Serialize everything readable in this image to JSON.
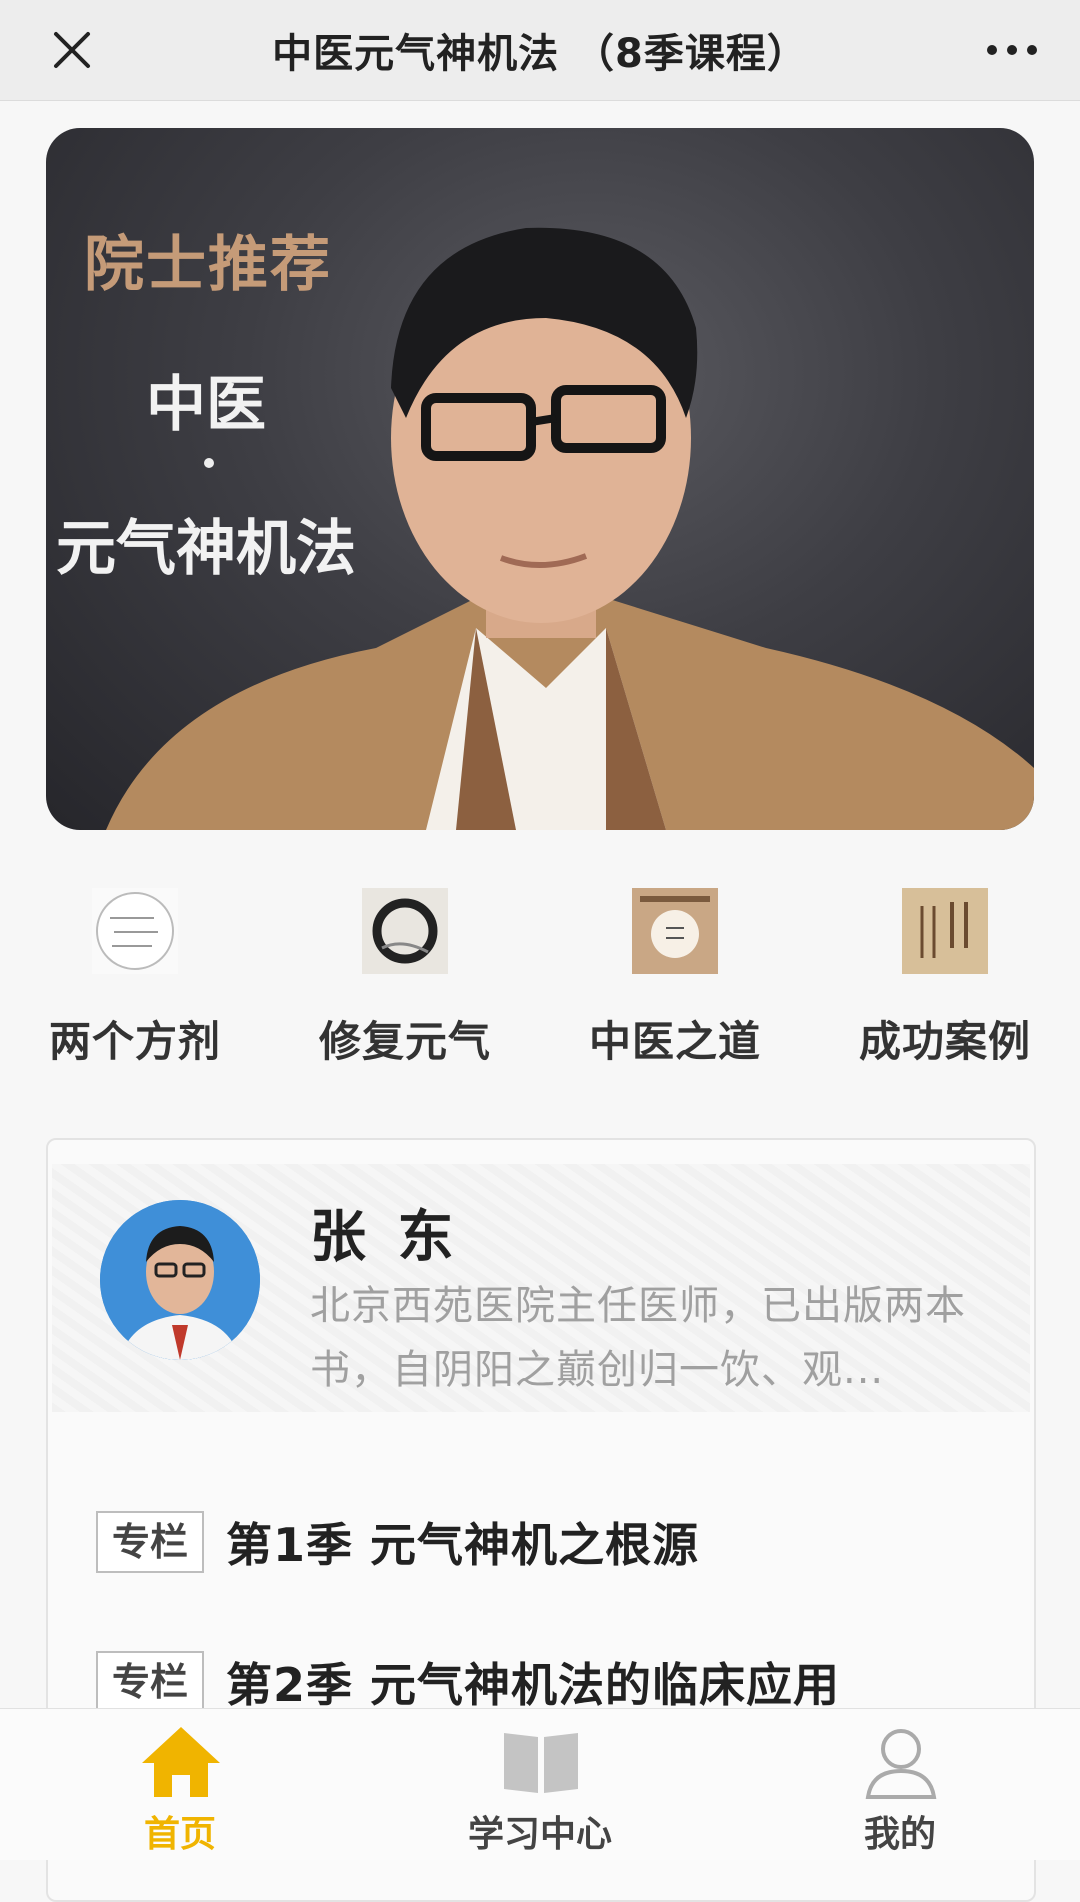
{
  "navbar": {
    "title": "中医元气神机法 （8季课程）",
    "close_icon": "close-icon",
    "more_icon": "more-dots-icon"
  },
  "banner": {
    "tag": "院士推荐",
    "line1": "中医",
    "line2": "元气神机法"
  },
  "categories": [
    {
      "label": "两个方剂",
      "icon": "formula-thumb"
    },
    {
      "label": "修复元气",
      "icon": "ink-circle-thumb"
    },
    {
      "label": "中医之道",
      "icon": "book-cover-thumb"
    },
    {
      "label": "成功案例",
      "icon": "book-thumb"
    }
  ],
  "author": {
    "name": "张 东",
    "description": "北京西苑医院主任医师，已出版两本书，自阴阳之巅创归一饮、观..."
  },
  "courses": [
    {
      "tag": "专栏",
      "title": "第1季 元气神机之根源"
    },
    {
      "tag": "专栏",
      "title": "第2季 元气神机法的临床应用"
    }
  ],
  "tabbar": {
    "items": [
      {
        "label": "首页",
        "icon": "home-icon",
        "active": true
      },
      {
        "label": "学习中心",
        "icon": "book-open-icon",
        "active": false
      },
      {
        "label": "我的",
        "icon": "user-icon",
        "active": false
      }
    ]
  },
  "colors": {
    "accent": "#f0b400",
    "banner_tag": "#c59b78"
  }
}
